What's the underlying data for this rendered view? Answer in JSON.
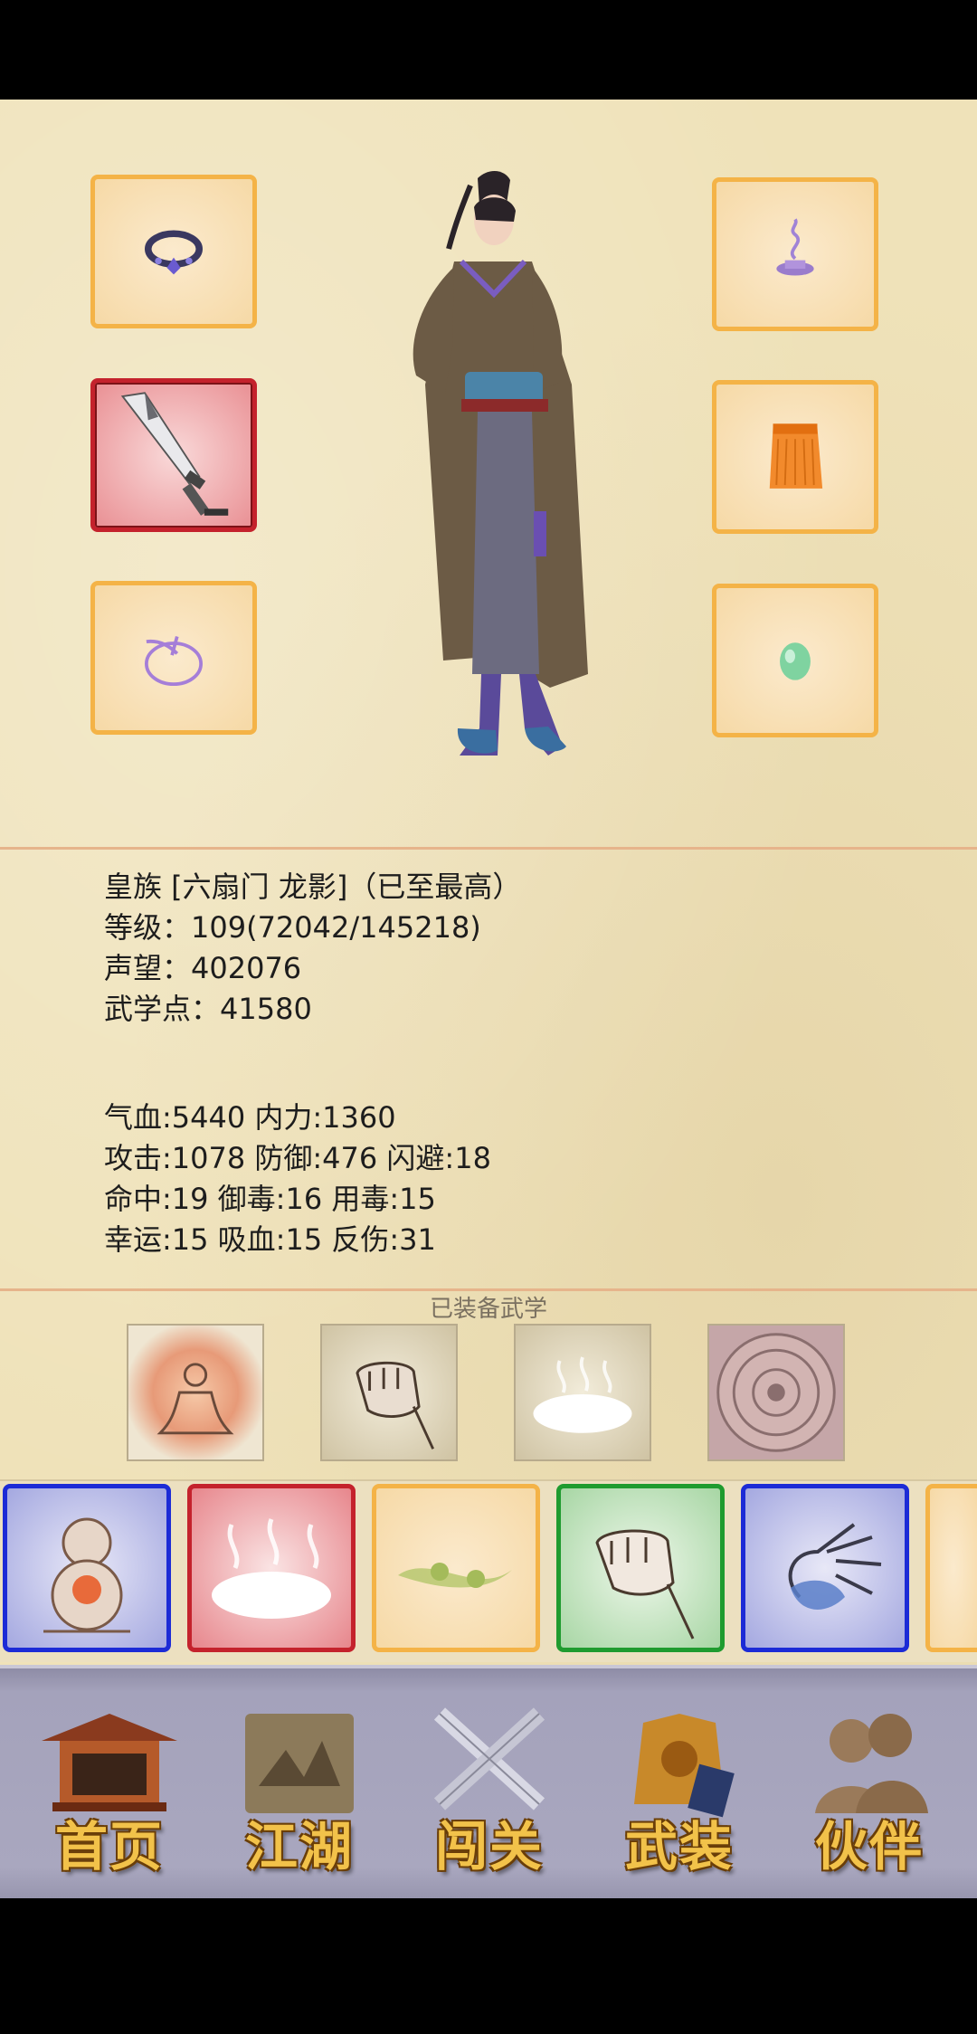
{
  "profile": {
    "title": "皇族 [六扇门 龙影]（已至最高）",
    "level": "等级：109(72042/145218)",
    "reputation": "声望：402076",
    "martial_points": "武学点：41580"
  },
  "stats": {
    "line1": "气血:5440  内力:1360",
    "line2": "攻击:1078  防御:476  闪避:18",
    "line3": "命中:19  御毒:16  用毒:15",
    "line4": "幸运:15  吸血:15  反伤:31"
  },
  "equipped_skills_label": "已装备武学",
  "equipment_slots": [
    {
      "icon": "bracelet-icon"
    },
    {
      "icon": "incense-icon"
    },
    {
      "icon": "broadsword-icon",
      "rarity_color": "#c4222c"
    },
    {
      "icon": "robe-icon"
    },
    {
      "icon": "ring-icon"
    },
    {
      "icon": "jade-icon"
    }
  ],
  "skill_tiles": [
    {
      "icon": "meditation-icon"
    },
    {
      "icon": "fist-icon"
    },
    {
      "icon": "cloud-icon"
    },
    {
      "icon": "seal-icon"
    }
  ],
  "skill_cards": [
    {
      "icon": "gourd-icon",
      "color": "#1c2bd6"
    },
    {
      "icon": "cloud-icon",
      "color": "#c4222c"
    },
    {
      "icon": "herb-icon",
      "color": "#f4b347"
    },
    {
      "icon": "fist-icon",
      "color": "#1f9b2f"
    },
    {
      "icon": "open-palm-icon",
      "color": "#1c2bd6"
    }
  ],
  "nav": [
    {
      "label": "首页",
      "icon": "pavilion-icon"
    },
    {
      "label": "江湖",
      "icon": "scroll-map-icon"
    },
    {
      "label": "闯关",
      "icon": "crossed-swords-icon"
    },
    {
      "label": "武装",
      "icon": "armor-icon"
    },
    {
      "label": "伙伴",
      "icon": "companions-icon"
    }
  ]
}
